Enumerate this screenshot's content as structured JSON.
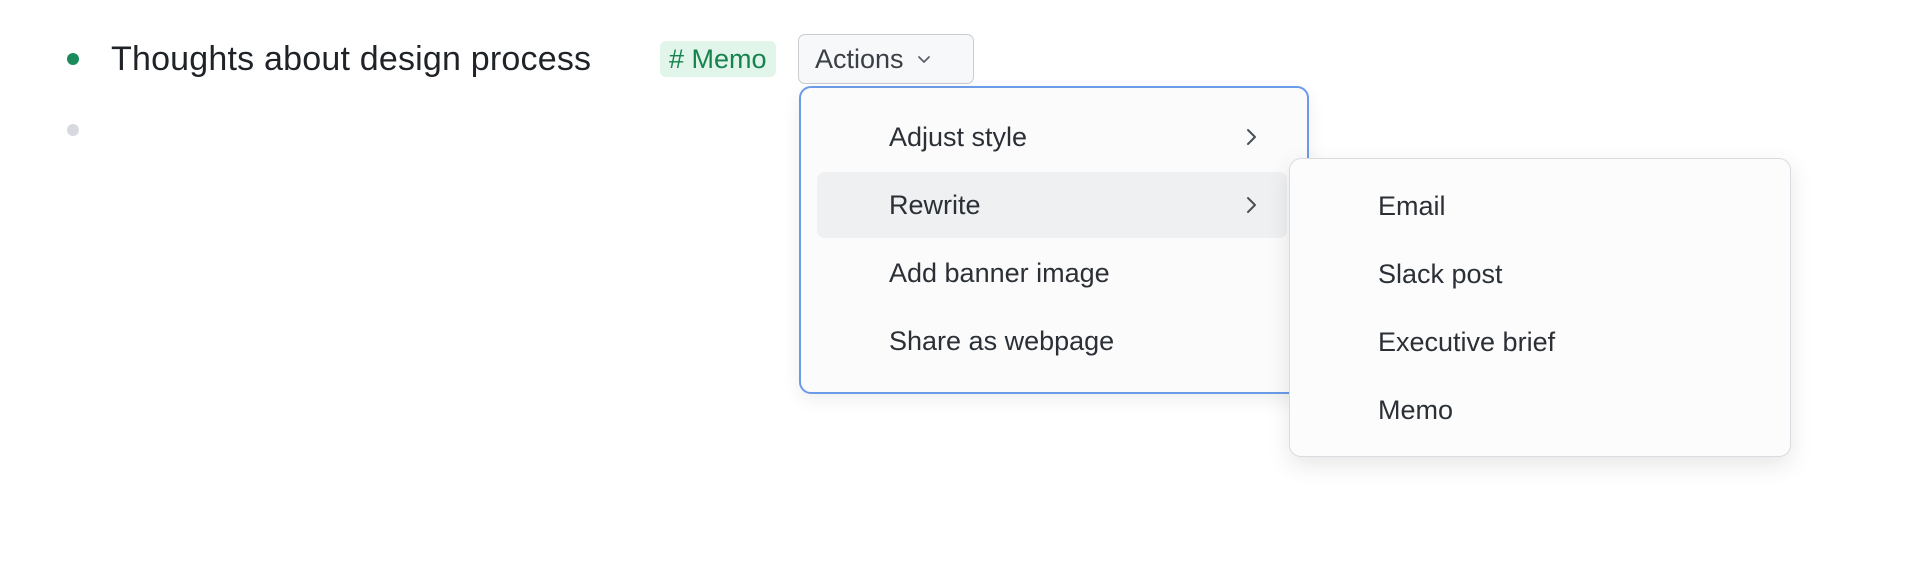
{
  "outline": {
    "items": [
      {
        "text": "Thoughts about design process",
        "tag": "# Memo"
      },
      {
        "text": ""
      }
    ]
  },
  "actions": {
    "label": "Actions"
  },
  "menu": {
    "items": [
      {
        "label": "Adjust style",
        "has_submenu": true
      },
      {
        "label": "Rewrite",
        "has_submenu": true,
        "active": true
      },
      {
        "label": "Add banner image"
      },
      {
        "label": "Share as webpage"
      }
    ]
  },
  "submenu": {
    "items": [
      {
        "label": "Email"
      },
      {
        "label": "Slack post"
      },
      {
        "label": "Executive brief"
      },
      {
        "label": "Memo"
      }
    ]
  },
  "colors": {
    "bullet_active": "#1b8a5a",
    "bullet_empty": "#d6d9de",
    "tag_bg": "#e1f5ea",
    "tag_text": "#16834e",
    "menu_focus_border": "#6b9be6"
  }
}
